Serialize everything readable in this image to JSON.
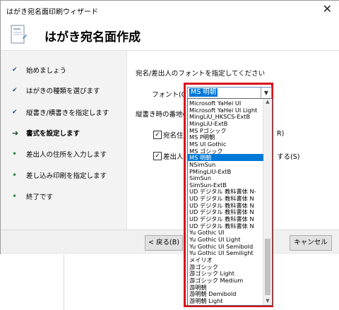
{
  "window": {
    "title": "はがき宛名面印刷ウィザード",
    "close_icon": "close-icon"
  },
  "header": {
    "title": "はがき宛名面作成",
    "icon": "postcard-wizard-icon"
  },
  "steps": [
    {
      "label": "始めましょう",
      "status": "done"
    },
    {
      "label": "はがきの種類を選びます",
      "status": "done"
    },
    {
      "label": "縦書き/横書きを指定します",
      "status": "done"
    },
    {
      "label": "書式を設定します",
      "status": "current"
    },
    {
      "label": "差出人の住所を入力します",
      "status": "todo"
    },
    {
      "label": "差し込み印刷を指定します",
      "status": "todo"
    },
    {
      "label": "終了です",
      "status": "todo"
    }
  ],
  "right": {
    "heading": "宛名/差出人のフォントを指定してください",
    "font_label": "フォント(O):",
    "font_value": "MS 明朝",
    "number_label": "縦書き時の番地の",
    "check1_prefix": "宛名住",
    "check1_suffix": "を漢数字に変換する(R)",
    "check1_suffix_visible": "R)",
    "check2_prefix": "差出人",
    "check2_suffix_visible": "する(S)"
  },
  "font_list": [
    "Microsoft YaHei UI",
    "Microsoft YaHei UI Light",
    "MingLiU_HKSCS-ExtB",
    "MingLiU-ExtB",
    "MS Pゴシック",
    "MS P明朝",
    "MS UI Gothic",
    "MS ゴシック",
    "MS 明朝",
    "NSimSun",
    "PMingLiU-ExtB",
    "SimSun",
    "SimSun-ExtB",
    "UD デジタル 教科書体 N-",
    "UD デジタル 教科書体 N",
    "UD デジタル 教科書体 N",
    "UD デジタル 教科書体 N",
    "UD デジタル 教科書体 N",
    "UD デジタル 教科書体 N",
    "Yu Gothic UI",
    "Yu Gothic UI Light",
    "Yu Gothic UI Semibold",
    "Yu Gothic UI Semilight",
    "メイリオ",
    "游ゴシック",
    "游ゴシック Light",
    "游ゴシック Medium",
    "游明朝",
    "游明朝 Demibold",
    "游明朝 Light"
  ],
  "selected_font_index": 8,
  "buttons": {
    "back": "< 戻る(B)",
    "cancel": "キャンセル"
  },
  "colors": {
    "highlight": "#0078d7",
    "red_outline": "#d8121b"
  }
}
